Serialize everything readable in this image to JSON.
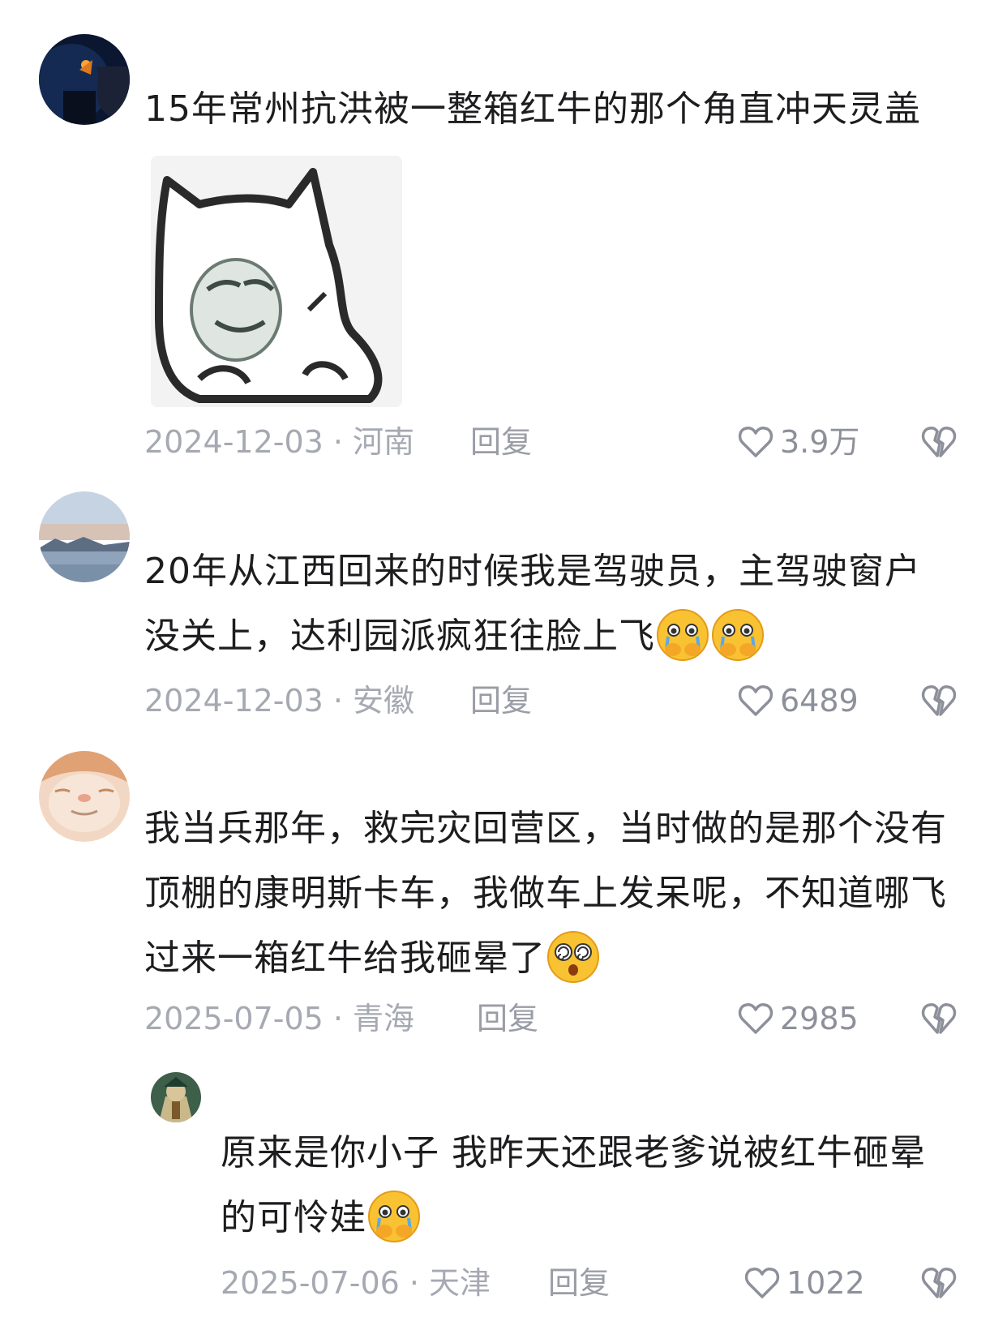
{
  "comments": [
    {
      "text": "15年常州抗洪被一整箱红牛的那个角直冲天灵盖",
      "date": "2024-12-03",
      "location": "河南",
      "reply_label": "回复",
      "likes": "3.9万"
    },
    {
      "text": "20年从江西回来的时候我是驾驶员，主驾驶窗户没关上，达利园派疯狂往脸上飞",
      "emojis": [
        "crying-pleading-emoji",
        "crying-pleading-emoji"
      ],
      "date": "2024-12-03",
      "location": "安徽",
      "reply_label": "回复",
      "likes": "6489"
    },
    {
      "text": "我当兵那年，救完灾回营区，当时做的是那个没有顶棚的康明斯卡车，我做车上发呆呢，不知道哪飞过来一箱红牛给我砸晕了",
      "emojis": [
        "dizzy-face-emoji"
      ],
      "date": "2025-07-05",
      "location": "青海",
      "reply_label": "回复",
      "likes": "2985"
    },
    {
      "text": "原来是你小子 我昨天还跟老爹说被红牛砸晕的可怜娃",
      "emojis": [
        "crying-pleading-emoji"
      ],
      "date": "2025-07-06",
      "location": "天津",
      "reply_label": "回复",
      "likes": "1022"
    }
  ],
  "separator": "·",
  "colors": {
    "meta": "#a6a9b2",
    "text": "#1d1d1f"
  }
}
